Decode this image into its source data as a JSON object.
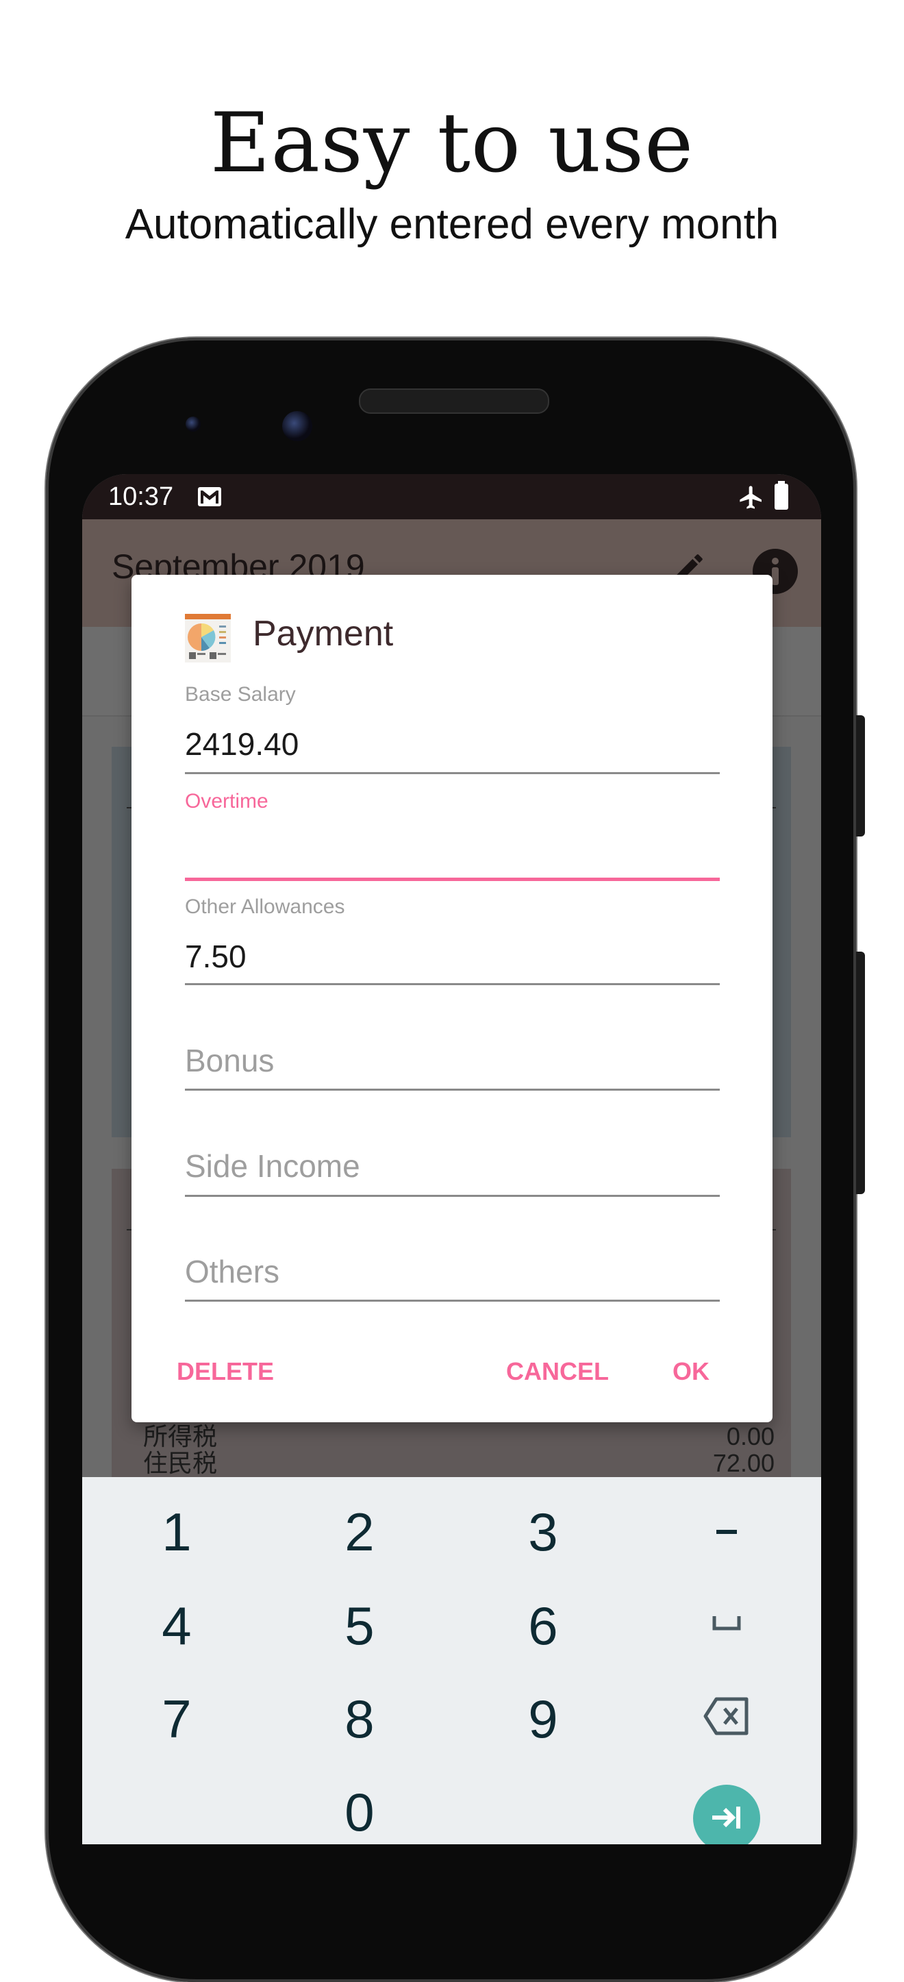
{
  "promo": {
    "headline": "Easy to use",
    "subline": "Automatically entered every month"
  },
  "status_bar": {
    "time": "10:37",
    "icons": [
      "gmail-icon",
      "airplane-mode-icon",
      "battery-icon"
    ]
  },
  "app_bar": {
    "title": "September 2019",
    "actions": [
      "edit-icon",
      "info-icon"
    ]
  },
  "background_list": [
    {
      "label": "所得税",
      "value": "0.00"
    },
    {
      "label": "住民税",
      "value": "72.00"
    }
  ],
  "dialog": {
    "icon": "payment-report-icon",
    "title": "Payment",
    "fields": [
      {
        "label": "Base Salary",
        "value": "2419.40",
        "placeholder": ""
      },
      {
        "label": "Overtime",
        "value": "",
        "placeholder": "",
        "focused": true
      },
      {
        "label": "Other Allowances",
        "value": "7.50",
        "placeholder": ""
      },
      {
        "label": "",
        "value": "",
        "placeholder": "Bonus"
      },
      {
        "label": "",
        "value": "",
        "placeholder": "Side Income"
      },
      {
        "label": "",
        "value": "",
        "placeholder": "Others"
      }
    ],
    "buttons": {
      "delete": "DELETE",
      "cancel": "CANCEL",
      "ok": "OK"
    }
  },
  "keyboard": {
    "rows": [
      [
        "1",
        "2",
        "3",
        "-"
      ],
      [
        "4",
        "5",
        "6",
        "space-icon"
      ],
      [
        "7",
        "8",
        "9",
        "backspace-icon"
      ],
      [
        "",
        "0",
        "",
        "next-icon"
      ]
    ]
  },
  "colors": {
    "accent": "#f7679a",
    "status_bar": "#1f1617",
    "keyboard_bg": "#eceff1",
    "keyboard_action": "#4db6ac"
  }
}
